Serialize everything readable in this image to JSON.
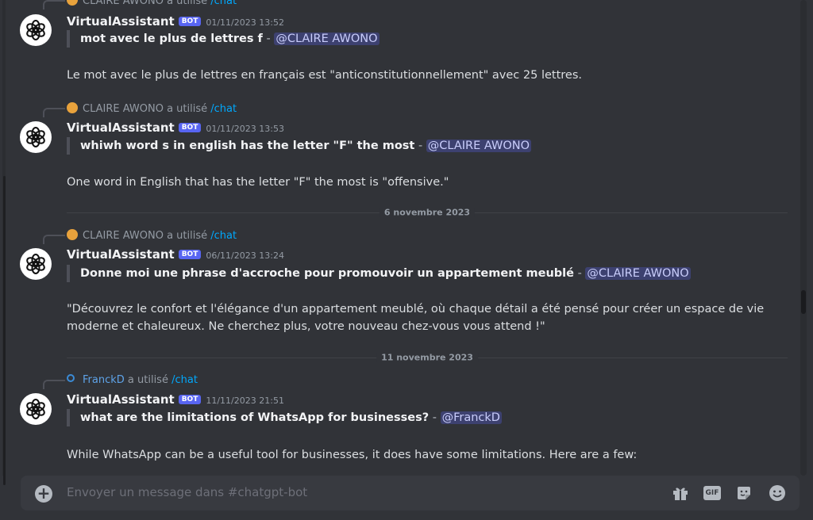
{
  "messages": [
    {
      "reply_user": "CLAIRE AWONO",
      "reply_suffix": " a utilisé ",
      "reply_cmd": "/chat",
      "author": "VirtualAssistant",
      "bot_tag": "BOT",
      "timestamp": "01/11/2023 13:52",
      "question": "mot avec le plus de lettres f",
      "sep": " - ",
      "mention": "@CLAIRE AWONO",
      "answer": "Le mot avec le plus de lettres en français est \"anticonstitutionnellement\" avec 25 lettres."
    },
    {
      "reply_user": "CLAIRE AWONO",
      "reply_suffix": " a utilisé ",
      "reply_cmd": "/chat",
      "author": "VirtualAssistant",
      "bot_tag": "BOT",
      "timestamp": "01/11/2023 13:53",
      "question": "whiwh word s in english has the letter \"F\" the most",
      "sep": " - ",
      "mention": "@CLAIRE AWONO",
      "answer": "One word in English that has the letter \"F\" the most is \"offensive.\""
    },
    {
      "reply_user": "CLAIRE AWONO",
      "reply_suffix": " a utilisé ",
      "reply_cmd": "/chat",
      "author": "VirtualAssistant",
      "bot_tag": "BOT",
      "timestamp": "06/11/2023 13:24",
      "question": "Donne moi une phrase d'accroche pour promouvoir un appartement meublé",
      "sep": " - ",
      "mention": "@CLAIRE AWONO",
      "answer_line1": "\"Découvrez le confort et l'élégance d'un appartement meublé, où chaque détail a été pensé pour créer un espace de vie",
      "answer_line2": "moderne et chaleureux. Ne cherchez plus, votre nouveau chez-vous vous attend !\""
    },
    {
      "reply_user": "FranckD",
      "reply_suffix": " a utilisé ",
      "reply_cmd": "/chat",
      "author": "VirtualAssistant",
      "bot_tag": "BOT",
      "timestamp": "11/11/2023 21:51",
      "question": "what are the limitations of WhatsApp for businesses?",
      "sep": " - ",
      "mention": "@FranckD",
      "answer": "While WhatsApp can be a useful tool for businesses, it does have some limitations. Here are a few:"
    }
  ],
  "dividers": [
    "6 novembre 2023",
    "11 novembre 2023"
  ],
  "composer": {
    "placeholder": "Envoyer un message dans #chatgpt-bot",
    "icons": [
      "gift-icon",
      "gif-icon",
      "sticker-icon",
      "emoji-icon"
    ],
    "gif_label": "GIF"
  },
  "colors": {
    "background": "#313338",
    "bot_badge": "#5865f2",
    "mention_text": "#c9cdfb",
    "command": "#00a8fc"
  }
}
